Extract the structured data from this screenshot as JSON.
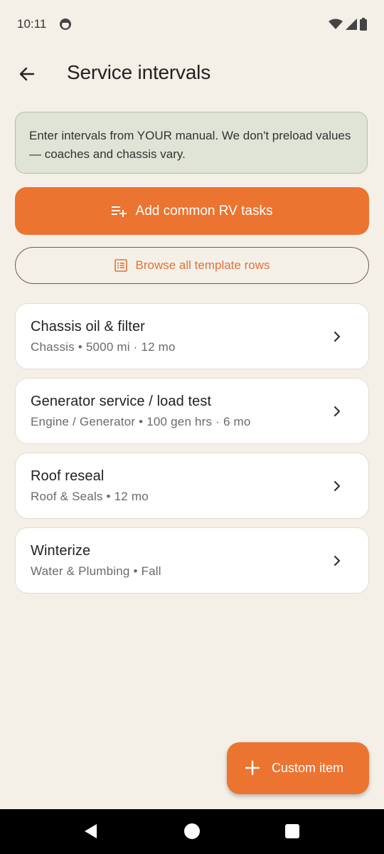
{
  "status": {
    "time": "10:11"
  },
  "header": {
    "title": "Service intervals"
  },
  "banner": {
    "text": "Enter intervals from YOUR manual. We don't preload values — coaches and chassis vary."
  },
  "actions": {
    "add_common": "Add common RV tasks",
    "browse_templates": "Browse all template rows"
  },
  "items": [
    {
      "title": "Chassis oil & filter",
      "subtitle": "Chassis • 5000 mi · 12 mo"
    },
    {
      "title": "Generator service / load test",
      "subtitle": "Engine / Generator • 100 gen hrs · 6 mo"
    },
    {
      "title": "Roof reseal",
      "subtitle": "Roof & Seals • 12 mo"
    },
    {
      "title": "Winterize",
      "subtitle": "Water & Plumbing • Fall"
    }
  ],
  "fab": {
    "label": "Custom item"
  },
  "colors": {
    "accent": "#EB7430",
    "background": "#F4F0E8",
    "banner": "#E0E4D6"
  }
}
